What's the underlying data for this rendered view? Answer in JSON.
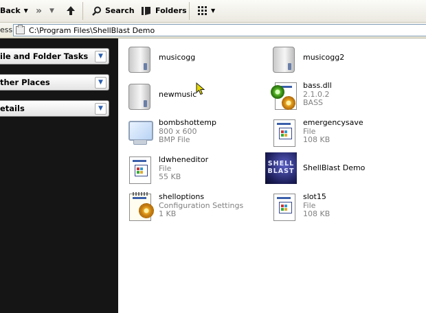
{
  "toolbar": {
    "back_label": "Back",
    "search_label": "Search",
    "folders_label": "Folders"
  },
  "address": {
    "label": "ess",
    "path": "C:\\Program Files\\ShellBlast Demo"
  },
  "taskpane": {
    "panels": [
      {
        "label": "ile and Folder Tasks"
      },
      {
        "label": "ther Places"
      },
      {
        "label": "etails"
      }
    ]
  },
  "files": [
    {
      "name": "musicogg",
      "line2": "",
      "line3": "",
      "icon": "drive-icon"
    },
    {
      "name": "musicogg2",
      "line2": "",
      "line3": "",
      "icon": "drive-icon"
    },
    {
      "name": "newmusic",
      "line2": "",
      "line3": "",
      "icon": "drive-icon"
    },
    {
      "name": "bass.dll",
      "line2": "2.1.0.2",
      "line3": "BASS",
      "icon": "dll-icon"
    },
    {
      "name": "bombshottemp",
      "line2": "800 x 600",
      "line3": "BMP File",
      "icon": "bmp-icon"
    },
    {
      "name": "emergencysave",
      "line2": "File",
      "line3": "108 KB",
      "icon": "file-icon"
    },
    {
      "name": "ldwheneditor",
      "line2": "File",
      "line3": "55 KB",
      "icon": "file-icon"
    },
    {
      "name": "ShellBlast Demo",
      "line2": "",
      "line3": "",
      "icon": "shellblast-app-icon"
    },
    {
      "name": "shelloptions",
      "line2": "Configuration Settings",
      "line3": "1 KB",
      "icon": "config-icon"
    },
    {
      "name": "slot15",
      "line2": "File",
      "line3": "108 KB",
      "icon": "file-icon"
    }
  ],
  "logo_text": "SHELL BLAST"
}
